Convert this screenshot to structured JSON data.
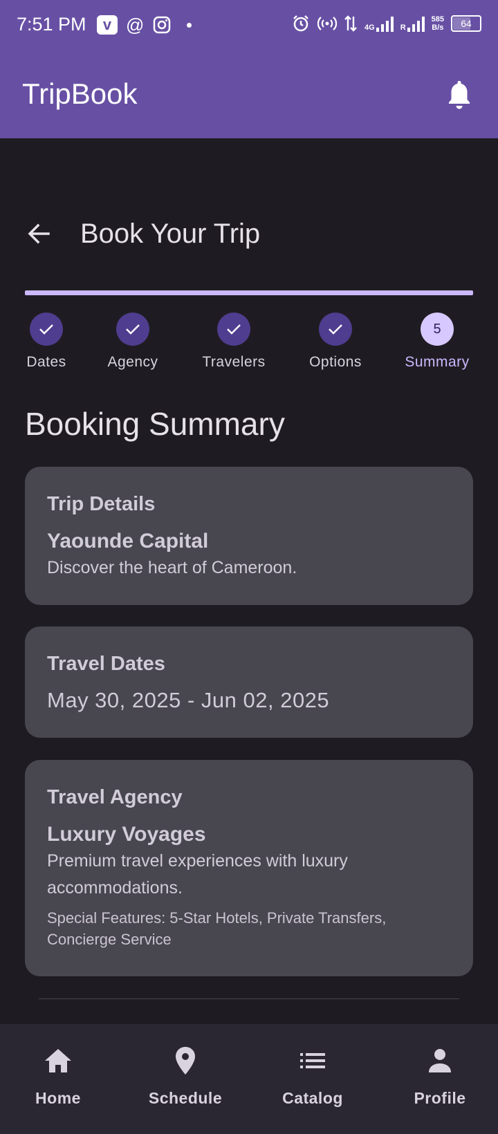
{
  "status_bar": {
    "time": "7:51 PM",
    "net_type": "4G",
    "roaming": "R",
    "net_speed_value": "585",
    "net_speed_unit": "B/s",
    "battery_level": "64"
  },
  "app_bar": {
    "title": "TripBook",
    "bell_icon": "notifications-icon"
  },
  "page": {
    "title": "Book Your Trip"
  },
  "stepper": {
    "progress": 1.0,
    "steps": [
      {
        "label": "Dates",
        "state": "done"
      },
      {
        "label": "Agency",
        "state": "done"
      },
      {
        "label": "Travelers",
        "state": "done"
      },
      {
        "label": "Options",
        "state": "done"
      },
      {
        "label": "Summary",
        "state": "active",
        "number": "5"
      }
    ]
  },
  "summary": {
    "heading": "Booking Summary",
    "trip": {
      "title": "Trip Details",
      "name": "Yaounde Capital",
      "description": "Discover the heart of Cameroon."
    },
    "dates": {
      "title": "Travel Dates",
      "range": "May 30, 2025 - Jun 02, 2025"
    },
    "agency": {
      "title": "Travel Agency",
      "name": "Luxury Voyages",
      "description": "Premium travel experiences with luxury accommodations.",
      "features": "Special Features: 5-Star Hotels, Private Transfers, Concierge Service"
    }
  },
  "bottom_nav": {
    "items": [
      {
        "label": "Home",
        "icon": "home-icon"
      },
      {
        "label": "Schedule",
        "icon": "location-pin-icon"
      },
      {
        "label": "Catalog",
        "icon": "list-icon"
      },
      {
        "label": "Profile",
        "icon": "person-icon"
      }
    ]
  },
  "colors": {
    "app_bar": "#6750a4",
    "background": "#1e1c22",
    "card": "#48464e",
    "step_done": "#4f3d8f",
    "step_active": "#d7c8ff",
    "accent": "#cbb8ff",
    "bottom_nav": "#2a2733"
  }
}
